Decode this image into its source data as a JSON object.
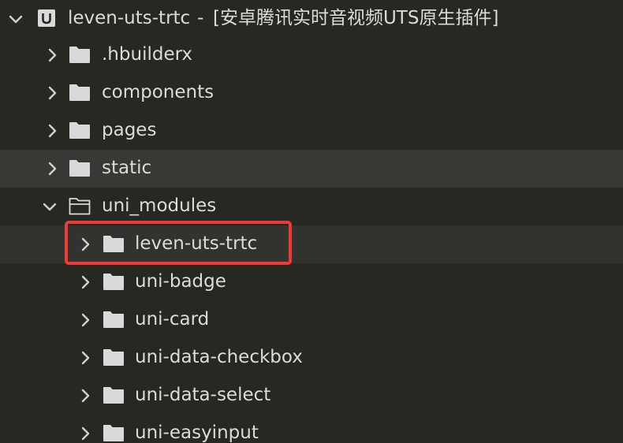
{
  "project": {
    "name": "leven-uts-trtc",
    "separator": "-",
    "description": "[安卓腾讯实时音视频UTS原生插件]",
    "icon": "uniapp-project-icon",
    "expanded": true
  },
  "tree": {
    "top_level": [
      {
        "label": ".hbuilderx",
        "icon": "folder-icon",
        "expanded": false
      },
      {
        "label": "components",
        "icon": "folder-icon",
        "expanded": false
      },
      {
        "label": "pages",
        "icon": "folder-icon",
        "expanded": false
      },
      {
        "label": "static",
        "icon": "folder-icon",
        "expanded": false,
        "state": "hover"
      },
      {
        "label": "uni_modules",
        "icon": "folder-open-icon",
        "expanded": true
      }
    ],
    "uni_modules_children": [
      {
        "label": "leven-uts-trtc",
        "icon": "folder-icon",
        "expanded": false,
        "state": "selected",
        "highlighted": true
      },
      {
        "label": "uni-badge",
        "icon": "folder-icon",
        "expanded": false
      },
      {
        "label": "uni-card",
        "icon": "folder-icon",
        "expanded": false
      },
      {
        "label": "uni-data-checkbox",
        "icon": "folder-icon",
        "expanded": false
      },
      {
        "label": "uni-data-select",
        "icon": "folder-icon",
        "expanded": false
      },
      {
        "label": "uni-easyinput",
        "icon": "folder-icon",
        "expanded": false
      }
    ]
  },
  "colors": {
    "background": "#272822",
    "hover_row": "#383935",
    "selected_row": "#32332e",
    "text": "#dcdcd6",
    "icon": "#d9d9d9",
    "highlight_border": "#ef3a3a"
  }
}
